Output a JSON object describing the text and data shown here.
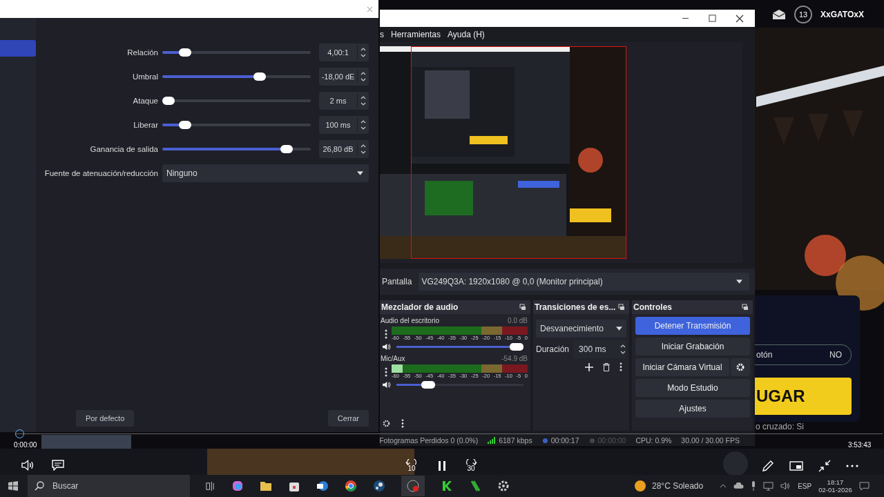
{
  "profile": {
    "level": "13",
    "name": "XxGATOxX"
  },
  "game_panel": {
    "option": "otón",
    "option_value": "NO",
    "play": "UGAR",
    "footer": "o cruzado: Si"
  },
  "filter_dialog": {
    "sidebar": {
      "items": [
        {
          "selected": true
        }
      ]
    },
    "settings": [
      {
        "label": "Relación",
        "level": 0.12,
        "value": "4,00:1"
      },
      {
        "label": "Umbral",
        "level": 0.67,
        "value": "-18,00 dE"
      },
      {
        "label": "Ataque",
        "level": 0.0,
        "value": "2 ms"
      },
      {
        "label": "Liberar",
        "level": 0.12,
        "value": "100 ms"
      },
      {
        "label": "Ganancia de salida",
        "level": 0.87,
        "value": "26,80 dB"
      }
    ],
    "dropdown": {
      "label": "Fuente de atenuación/reducción",
      "value": "Ninguno"
    },
    "buttons": [
      "Por defecto",
      "Cerrar"
    ]
  },
  "obs": {
    "menu": [
      "s",
      "Herramientas",
      "Ayuda (H)"
    ],
    "source": {
      "label": "Pantalla",
      "value": "VG249Q3A: 1920x1080 @ 0,0 (Monitor principal)"
    },
    "mixer": {
      "title": "Mezclador de audio",
      "channels": [
        {
          "name": "Audio del escritorio",
          "reading": "0.0 dB",
          "volume": {
            "level": 1.0
          },
          "scale": [
            "-60",
            "-55",
            "-50",
            "-45",
            "-40",
            "-35",
            "-30",
            "-25",
            "-20",
            "-15",
            "-10",
            "-5",
            "0"
          ]
        },
        {
          "name": "Mic/Aux",
          "reading": "-54.9 dB",
          "meter": {
            "level": 0.08
          },
          "volume": {
            "level": 0.22
          },
          "scale": [
            "-60",
            "-55",
            "-50",
            "-45",
            "-40",
            "-35",
            "-30",
            "-25",
            "-20",
            "-15",
            "-10",
            "-5",
            "0"
          ]
        }
      ]
    },
    "transitions": {
      "title": "Transiciones de es...",
      "type": "Desvanecimiento",
      "duration_label": "Duración",
      "duration": "300 ms"
    },
    "controls": {
      "title": "Controles",
      "buttons": [
        {
          "label": "Detener Transmisión",
          "active": true
        },
        {
          "label": "Iniciar Grabación",
          "active": false
        },
        {
          "label": "Iniciar Cámara Virtual",
          "active": false
        },
        {
          "label": "Modo Estudio",
          "active": false
        },
        {
          "label": "Ajustes",
          "active": false
        }
      ]
    },
    "status_bar": {
      "dropped": "Fotogramas Perdidos 0 (0.0%)",
      "bitrate": "6187 kbps",
      "stream_time": "00:00:17",
      "record_time": "00:00:00",
      "cpu": "CPU: 0.9%",
      "fps": "30.00 / 30.00 FPS"
    }
  },
  "player": {
    "elapsed": "0:00:00",
    "total": "3:53:43",
    "level": 0,
    "rewind": "10",
    "forward": "30"
  },
  "taskbar": {
    "search": "Buscar",
    "weather": "28°C Soleado",
    "language": "ESP",
    "time": "18:17",
    "date": "02-01-2026"
  }
}
